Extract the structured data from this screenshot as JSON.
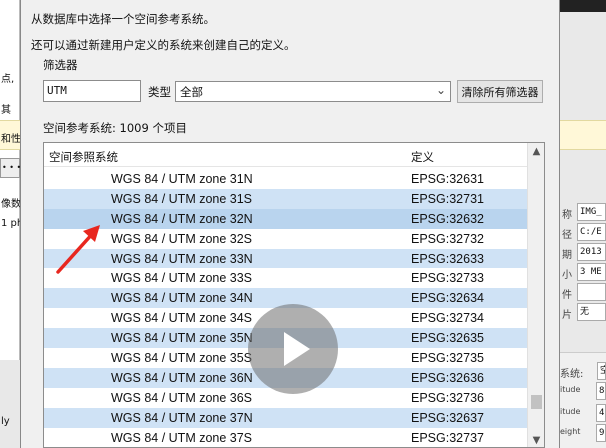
{
  "background_left": {
    "fragments": [
      "点,",
      "其",
      "和性",
      "• • •",
      "像数",
      "1 ph",
      "ly"
    ]
  },
  "background_right": {
    "props": [
      {
        "key": "称",
        "value": "IMG_"
      },
      {
        "key": "径",
        "value": "C:/E"
      },
      {
        "key": "期",
        "value": "2013"
      },
      {
        "key": "小",
        "value": "3 ME"
      },
      {
        "key": "件",
        "value": ""
      },
      {
        "key": "片",
        "value": "无"
      }
    ],
    "bottom": [
      {
        "key": "系统:",
        "value": "空"
      },
      {
        "key": "itude",
        "value": "8"
      },
      {
        "key": "itude",
        "value": "4"
      },
      {
        "key": "eight",
        "value": "9"
      }
    ]
  },
  "dialog": {
    "intro_line1": "从数据库中选择一个空间参考系统。",
    "intro_line2": "还可以通过新建用户定义的系统来创建自己的定义。",
    "filter_label": "筛选器",
    "filter_value": "UTM",
    "type_label": "类型",
    "type_value": "全部",
    "clear_button": "清除所有筛选器",
    "count_label": "空间参考系统: 1009 个项目",
    "columns": {
      "name": "空间参照系统",
      "definition": "定义"
    },
    "rows": [
      {
        "name": "WGS 84 / UTM zone 31N",
        "code": "EPSG:32631"
      },
      {
        "name": "WGS 84 / UTM zone 31S",
        "code": "EPSG:32731"
      },
      {
        "name": "WGS 84 / UTM zone 32N",
        "code": "EPSG:32632"
      },
      {
        "name": "WGS 84 / UTM zone 32S",
        "code": "EPSG:32732"
      },
      {
        "name": "WGS 84 / UTM zone 33N",
        "code": "EPSG:32633"
      },
      {
        "name": "WGS 84 / UTM zone 33S",
        "code": "EPSG:32733"
      },
      {
        "name": "WGS 84 / UTM zone 34N",
        "code": "EPSG:32634"
      },
      {
        "name": "WGS 84 / UTM zone 34S",
        "code": "EPSG:32734"
      },
      {
        "name": "WGS 84 / UTM zone 35N",
        "code": "EPSG:32635"
      },
      {
        "name": "WGS 84 / UTM zone 35S",
        "code": "EPSG:32735"
      },
      {
        "name": "WGS 84 / UTM zone 36N",
        "code": "EPSG:32636"
      },
      {
        "name": "WGS 84 / UTM zone 36S",
        "code": "EPSG:32736"
      },
      {
        "name": "WGS 84 / UTM zone 37N",
        "code": "EPSG:32637"
      },
      {
        "name": "WGS 84 / UTM zone 37S",
        "code": "EPSG:32737"
      }
    ]
  },
  "colors": {
    "row_highlight": "#cfe2f5",
    "row_selected": "#b9d4ee",
    "annotation_arrow": "#e8271f",
    "dialog_bg": "#f0f0f0"
  },
  "icons": [
    "chevron-down-icon",
    "scroll-up-icon",
    "scroll-down-icon",
    "play-icon",
    "annotation-arrow-icon"
  ]
}
